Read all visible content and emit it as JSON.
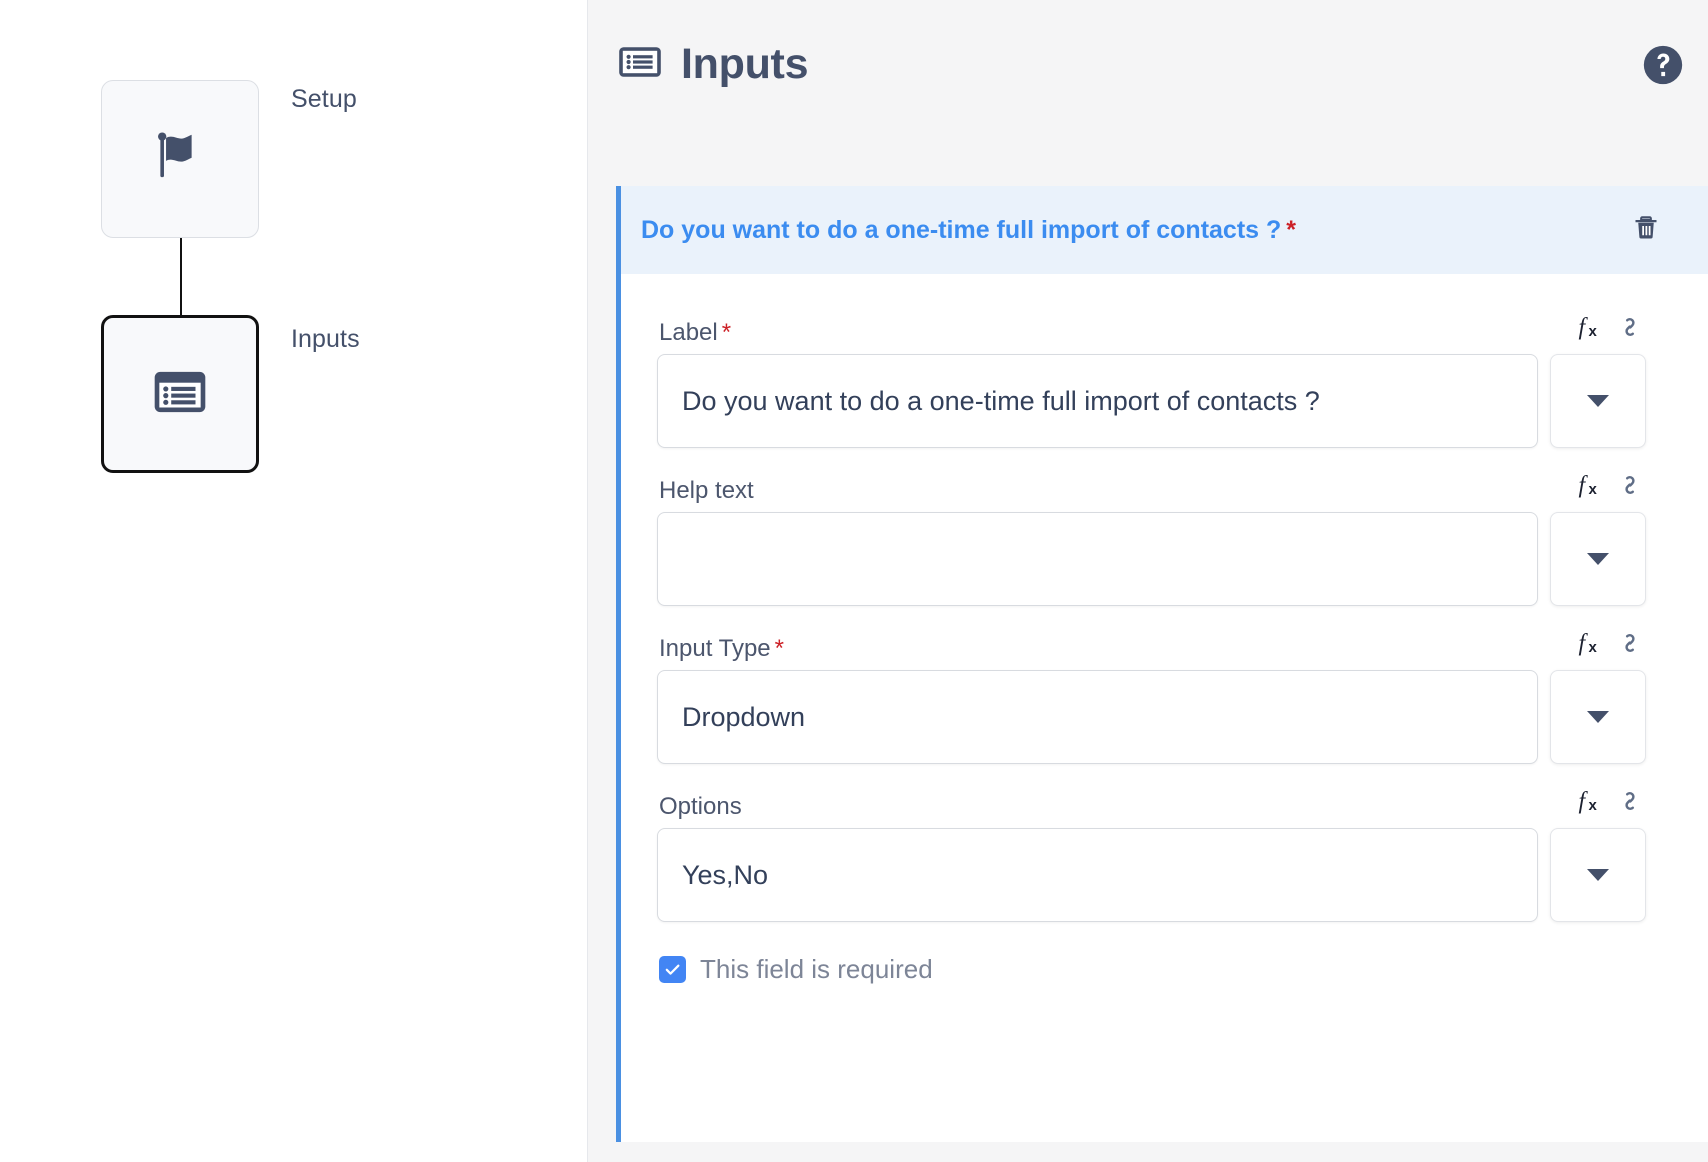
{
  "flow": {
    "nodes": [
      {
        "label": "Setup",
        "icon": "flag-icon",
        "selected": false
      },
      {
        "label": "Inputs",
        "icon": "form-list-icon",
        "selected": true
      }
    ]
  },
  "header": {
    "title": "Inputs",
    "icon": "form-list-icon",
    "help_icon": "help-circle-icon"
  },
  "field_card": {
    "title": "Do you want to do a one-time full import of contacts ?",
    "required_marker": "*",
    "delete_icon": "trash-icon",
    "accent_color": "#4a90e2",
    "title_color": "#3b8cf0",
    "header_bg": "#eaf2fb",
    "required_color": "#cc2127",
    "fields": [
      {
        "label": "Label",
        "required_marker": "*",
        "value": "Do you want to do a one-time full import of contacts ?",
        "placeholder": "",
        "fx_icon": "function-fx-icon",
        "link_icon": "chain-link-icon",
        "dropdown_icon": "caret-down-icon"
      },
      {
        "label": "Help text",
        "required_marker": "",
        "value": "",
        "placeholder": "",
        "fx_icon": "function-fx-icon",
        "link_icon": "chain-link-icon",
        "dropdown_icon": "caret-down-icon"
      },
      {
        "label": "Input Type",
        "required_marker": "*",
        "value": "Dropdown",
        "placeholder": "",
        "fx_icon": "function-fx-icon",
        "link_icon": "chain-link-icon",
        "dropdown_icon": "caret-down-icon"
      },
      {
        "label": "Options",
        "required_marker": "",
        "value": "Yes,No",
        "placeholder": "",
        "fx_icon": "function-fx-icon",
        "link_icon": "chain-link-icon",
        "dropdown_icon": "caret-down-icon"
      }
    ],
    "checkbox": {
      "label": "This field is required",
      "checked": true,
      "color": "#4285f4"
    }
  }
}
